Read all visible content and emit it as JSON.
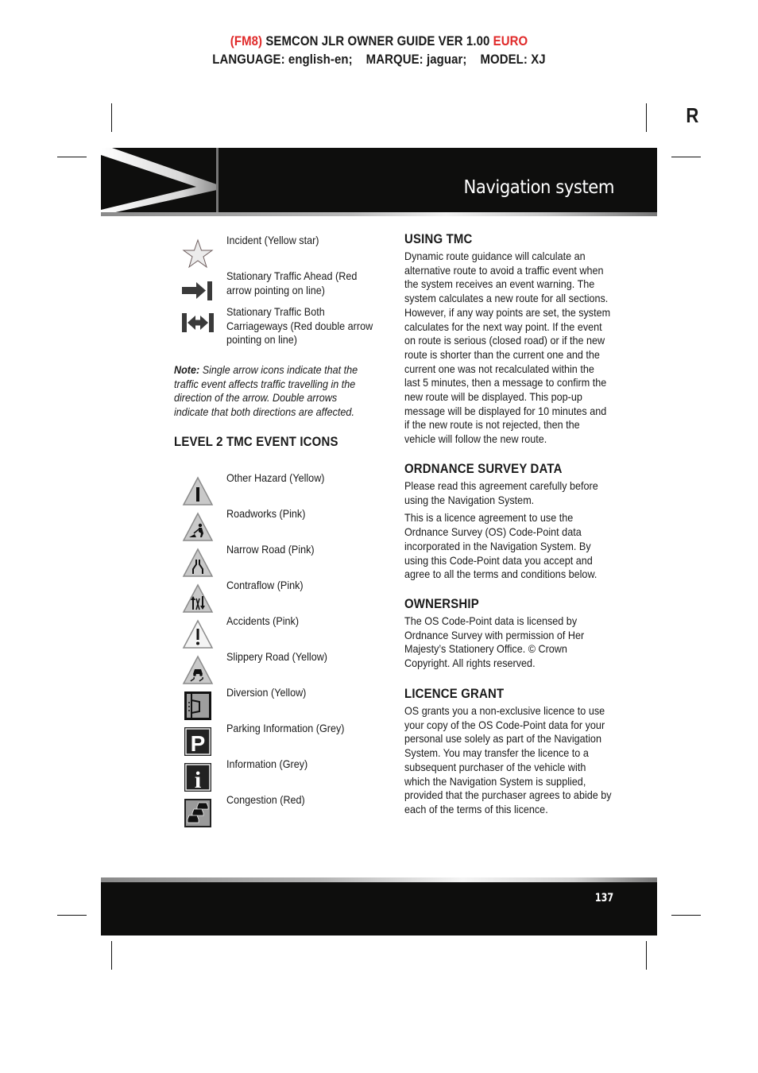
{
  "doc_header": {
    "line1_prefix": "(FM8)",
    "line1_main": " SEMCON JLR OWNER GUIDE VER 1.00 ",
    "line1_suffix": "EURO",
    "line2": "LANGUAGE: english-en;    MARQUE: jaguar;    MODEL: XJ"
  },
  "colors": {
    "header_red": "#e02a2a",
    "banner_bg": "#0e0e0d",
    "text": "#1a1a1a"
  },
  "section_tab_letter": "R",
  "banner": {
    "title": "Navigation system"
  },
  "level1_icons": [
    {
      "icon": "star-icon",
      "label": "Incident (Yellow star)"
    },
    {
      "icon": "arrow-to-line-icon",
      "label": "Stationary Traffic Ahead (Red arrow pointing on line)"
    },
    {
      "icon": "double-arrow-between-lines-icon",
      "label": "Stationary Traffic Both Carriageways (Red double arrow pointing on line)"
    }
  ],
  "note": {
    "prefix": "Note:",
    "text": " Single arrow icons indicate that the traffic event affects traffic travelling in the direction of the arrow. Double arrows indicate that both directions are affected."
  },
  "level2": {
    "heading": "LEVEL 2 TMC EVENT ICONS",
    "icons": [
      {
        "icon": "other-hazard-icon",
        "label": "Other Hazard (Yellow)"
      },
      {
        "icon": "roadworks-icon",
        "label": "Roadworks (Pink)"
      },
      {
        "icon": "narrow-road-icon",
        "label": "Narrow Road (Pink)"
      },
      {
        "icon": "contraflow-icon",
        "label": "Contraflow (Pink)"
      },
      {
        "icon": "accidents-icon",
        "label": "Accidents (Pink)"
      },
      {
        "icon": "slippery-road-icon",
        "label": "Slippery Road (Yellow)"
      },
      {
        "icon": "diversion-icon",
        "label": "Diversion (Yellow)"
      },
      {
        "icon": "parking-icon",
        "label": "Parking Information (Grey)"
      },
      {
        "icon": "information-icon",
        "label": "Information (Grey)"
      },
      {
        "icon": "congestion-icon",
        "label": "Congestion (Red)"
      }
    ]
  },
  "right_column": {
    "using_tmc": {
      "heading": "USING TMC",
      "p1": "Dynamic route guidance will calculate an alternative route to avoid a traffic event when the system receives an event warning. The system calculates a new route for all sections. However, if any way points are set, the system calculates for the next way point. If the event on route is serious (closed road) or if the new route is shorter than the current one and the current one was not recalculated within the last 5 minutes, then a message to confirm the new route will be displayed. This pop-up message will be displayed for 10 minutes and if the new route is not rejected, then the vehicle will follow the new route."
    },
    "ordnance": {
      "heading": "ORDNANCE SURVEY DATA",
      "p1": "Please read this agreement carefully before using the Navigation System.",
      "p2": "This is a licence agreement to use the Ordnance Survey (OS) Code-Point data incorporated in the Navigation System. By using this Code-Point data you accept and agree to all the terms and conditions below."
    },
    "ownership": {
      "heading": "OWNERSHIP",
      "p1": "The OS Code-Point data is licensed by Ordnance Survey with permission of Her Majesty’s Stationery Office. © Crown Copyright. All rights reserved."
    },
    "licence": {
      "heading": "LICENCE GRANT",
      "p1": "OS grants you a non-exclusive licence to use your copy of the OS Code-Point data for your personal use solely as part of the Navigation System. You may transfer the licence to a subsequent purchaser of the vehicle with which the Navigation System is supplied, provided that the purchaser agrees to abide by each of the terms of this licence."
    }
  },
  "footer": {
    "page_number": "137"
  }
}
